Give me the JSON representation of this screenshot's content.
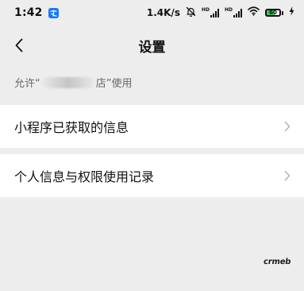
{
  "status_bar": {
    "time": "1:42",
    "net_speed": "1.4K/s",
    "sim1_label": "HD",
    "sim2_label": "HD",
    "battery_level": "60",
    "icons": [
      "app-notification-icon",
      "mute-bell-icon",
      "signal-icon",
      "signal-icon",
      "wifi-icon",
      "battery-icon",
      "charging-bolt-icon"
    ]
  },
  "nav": {
    "title": "设置",
    "back_icon": "chevron-left-icon"
  },
  "permission": {
    "prefix": "允许“",
    "visible_fragment": "店",
    "suffix": "”使用"
  },
  "list": {
    "items": [
      {
        "label": "小程序已获取的信息",
        "icon": "chevron-right-icon"
      },
      {
        "label": "个人信息与权限使用记录",
        "icon": "chevron-right-icon"
      }
    ]
  },
  "watermark": {
    "text": "crmeb"
  },
  "colors": {
    "background": "#ededed",
    "row_background": "#ffffff",
    "secondary_text": "#666666",
    "chevron": "#b2b2b2",
    "app_badge": "#1677ff",
    "battery_fill": "#34c759"
  }
}
